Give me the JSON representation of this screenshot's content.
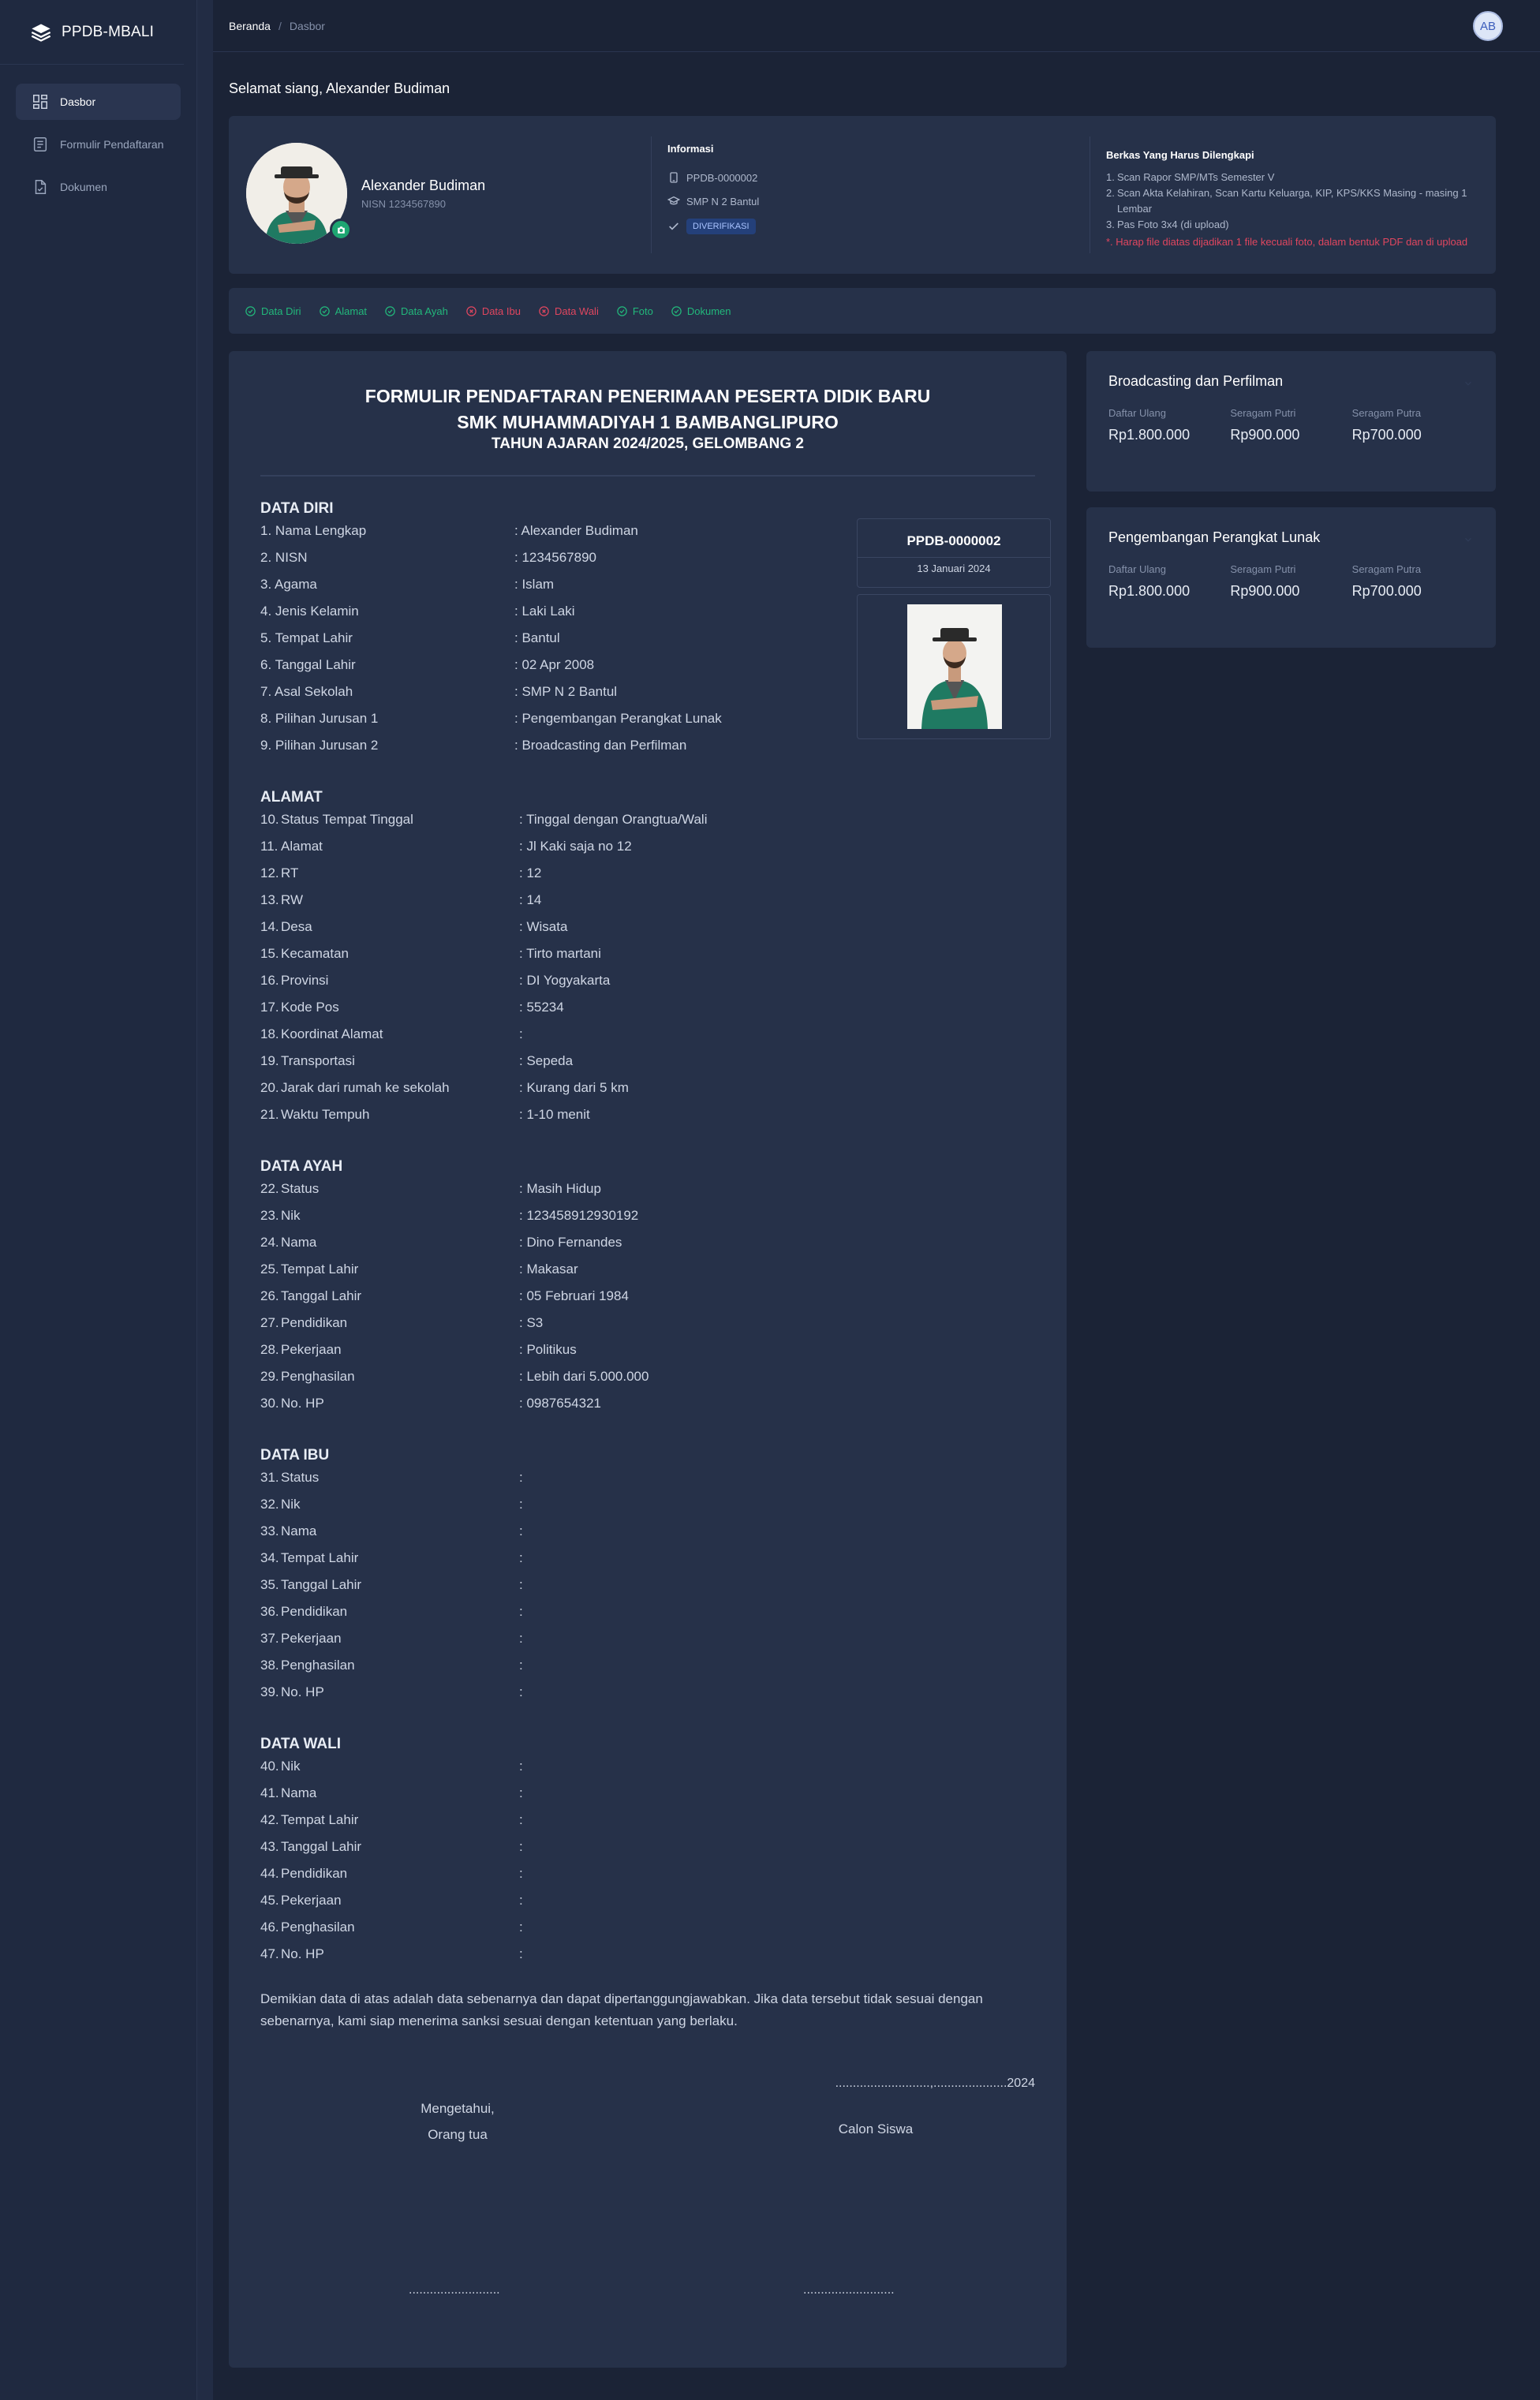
{
  "app": {
    "brand": "PPDB-MBALI",
    "avatar_initials": "AB"
  },
  "sidebar": {
    "items": [
      {
        "label": "Dasbor",
        "icon": "dashboard-icon",
        "active": true
      },
      {
        "label": "Formulir Pendaftaran",
        "icon": "form-icon",
        "active": false
      },
      {
        "label": "Dokumen",
        "icon": "document-icon",
        "active": false
      }
    ]
  },
  "breadcrumb": [
    "Beranda",
    "Dasbor"
  ],
  "greeting": "Selamat siang, Alexander Budiman",
  "profile": {
    "name": "Alexander Budiman",
    "nisn": "NISN 1234567890"
  },
  "info": {
    "title": "Informasi",
    "reg_no": "PPDB-0000002",
    "school": "SMP N 2 Bantul",
    "status": "DIVERIFIKASI"
  },
  "berkas": {
    "title": "Berkas Yang Harus Dilengkapi",
    "items": [
      "Scan Rapor SMP/MTs Semester V",
      "Scan Akta Kelahiran, Scan Kartu Keluarga, KIP, KPS/KKS Masing - masing 1 Lembar",
      "Pas Foto 3x4 (di upload)"
    ],
    "note": "*. Harap file diatas dijadikan 1 file kecuali foto, dalam bentuk PDF dan di upload"
  },
  "steps": [
    {
      "label": "Data Diri",
      "state": "done"
    },
    {
      "label": "Alamat",
      "state": "done"
    },
    {
      "label": "Data Ayah",
      "state": "done"
    },
    {
      "label": "Data Ibu",
      "state": "missing"
    },
    {
      "label": "Data Wali",
      "state": "missing"
    },
    {
      "label": "Foto",
      "state": "done"
    },
    {
      "label": "Dokumen",
      "state": "done"
    }
  ],
  "form": {
    "title1": "FORMULIR PENDAFTARAN PENERIMAAN PESERTA DIDIK BARU",
    "title2": "SMK MUHAMMADIYAH 1 BAMBANGLIPURO",
    "title3": "TAHUN AJARAN 2024/2025, GELOMBANG 2",
    "reg_no": "PPDB-0000002",
    "reg_date": "13 Januari 2024",
    "sections": {
      "diri": {
        "title": "DATA DIRI",
        "rows": [
          {
            "n": "1.",
            "label": "Nama Lengkap",
            "value": ": Alexander Budiman"
          },
          {
            "n": "2.",
            "label": "NISN",
            "value": ": 1234567890"
          },
          {
            "n": "3.",
            "label": "Agama",
            "value": ": Islam"
          },
          {
            "n": "4.",
            "label": "Jenis Kelamin",
            "value": ": Laki Laki"
          },
          {
            "n": "5.",
            "label": "Tempat Lahir",
            "value": ": Bantul"
          },
          {
            "n": "6.",
            "label": "Tanggal Lahir",
            "value": ": 02 Apr 2008"
          },
          {
            "n": "7.",
            "label": "Asal Sekolah",
            "value": ": SMP N 2 Bantul"
          },
          {
            "n": "8.",
            "label": "Pilihan Jurusan 1",
            "value": ": Pengembangan Perangkat Lunak"
          },
          {
            "n": "9.",
            "label": "Pilihan Jurusan 2",
            "value": ": Broadcasting dan Perfilman"
          }
        ]
      },
      "alamat": {
        "title": "ALAMAT",
        "rows": [
          {
            "n": "10.",
            "label": "Status Tempat Tinggal",
            "value": ": Tinggal dengan Orangtua/Wali"
          },
          {
            "n": "11.",
            "label": "Alamat",
            "value": ": Jl Kaki saja no 12"
          },
          {
            "n": "12.",
            "label": "RT",
            "value": ": 12"
          },
          {
            "n": "13.",
            "label": "RW",
            "value": ": 14"
          },
          {
            "n": "14.",
            "label": "Desa",
            "value": ": Wisata"
          },
          {
            "n": "15.",
            "label": "Kecamatan",
            "value": ": Tirto martani"
          },
          {
            "n": "16.",
            "label": "Provinsi",
            "value": ": DI Yogyakarta"
          },
          {
            "n": "17.",
            "label": "Kode Pos",
            "value": ": 55234"
          },
          {
            "n": "18.",
            "label": "Koordinat Alamat",
            "value": ":"
          },
          {
            "n": "19.",
            "label": "Transportasi",
            "value": ": Sepeda"
          },
          {
            "n": "20.",
            "label": "Jarak dari rumah ke sekolah",
            "value": ": Kurang dari 5 km"
          },
          {
            "n": "21.",
            "label": "Waktu Tempuh",
            "value": ": 1-10 menit"
          }
        ]
      },
      "ayah": {
        "title": "DATA AYAH",
        "rows": [
          {
            "n": "22.",
            "label": "Status",
            "value": ": Masih Hidup"
          },
          {
            "n": "23.",
            "label": "Nik",
            "value": ": 123458912930192"
          },
          {
            "n": "24.",
            "label": "Nama",
            "value": ": Dino Fernandes"
          },
          {
            "n": "25.",
            "label": "Tempat Lahir",
            "value": ": Makasar"
          },
          {
            "n": "26.",
            "label": "Tanggal Lahir",
            "value": ": 05 Februari 1984"
          },
          {
            "n": "27.",
            "label": "Pendidikan",
            "value": ": S3"
          },
          {
            "n": "28.",
            "label": "Pekerjaan",
            "value": ": Politikus"
          },
          {
            "n": "29.",
            "label": "Penghasilan",
            "value": ": Lebih dari 5.000.000"
          },
          {
            "n": "30.",
            "label": "No. HP",
            "value": ": 0987654321"
          }
        ]
      },
      "ibu": {
        "title": "DATA IBU",
        "rows": [
          {
            "n": "31.",
            "label": "Status",
            "value": ":"
          },
          {
            "n": "32.",
            "label": "Nik",
            "value": ":"
          },
          {
            "n": "33.",
            "label": "Nama",
            "value": ":"
          },
          {
            "n": "34.",
            "label": "Tempat Lahir",
            "value": ":"
          },
          {
            "n": "35.",
            "label": "Tanggal Lahir",
            "value": ":"
          },
          {
            "n": "36.",
            "label": "Pendidikan",
            "value": ":"
          },
          {
            "n": "37.",
            "label": "Pekerjaan",
            "value": ":"
          },
          {
            "n": "38.",
            "label": "Penghasilan",
            "value": ":"
          },
          {
            "n": "39.",
            "label": "No. HP",
            "value": ":"
          }
        ]
      },
      "wali": {
        "title": "DATA WALI",
        "rows": [
          {
            "n": "40.",
            "label": "Nik",
            "value": ":"
          },
          {
            "n": "41.",
            "label": "Nama",
            "value": ":"
          },
          {
            "n": "42.",
            "label": "Tempat Lahir",
            "value": ":"
          },
          {
            "n": "43.",
            "label": "Tanggal Lahir",
            "value": ":"
          },
          {
            "n": "44.",
            "label": "Pendidikan",
            "value": ":"
          },
          {
            "n": "45.",
            "label": "Pekerjaan",
            "value": ":"
          },
          {
            "n": "46.",
            "label": "Penghasilan",
            "value": ":"
          },
          {
            "n": "47.",
            "label": "No. HP",
            "value": ":"
          }
        ]
      }
    },
    "statement": "Demikian data di atas adalah data sebenarnya dan dapat dipertanggungjawabkan. Jika data tersebut tidak sesuai dengan sebenarnya, kami siap menerima sanksi sesuai dengan ketentuan yang berlaku.",
    "sign_date": "...........................,.....................2024",
    "sign_left_1": "Mengetahui,",
    "sign_left_2": "Orang tua",
    "sign_right": "Calon Siswa",
    "sign_dots": ".........................."
  },
  "fees": [
    {
      "title": "Broadcasting dan Perfilman",
      "items": [
        {
          "label": "Daftar Ulang",
          "value": "Rp1.800.000"
        },
        {
          "label": "Seragam Putri",
          "value": "Rp900.000"
        },
        {
          "label": "Seragam Putra",
          "value": "Rp700.000"
        }
      ]
    },
    {
      "title": "Pengembangan Perangkat Lunak",
      "items": [
        {
          "label": "Daftar Ulang",
          "value": "Rp1.800.000"
        },
        {
          "label": "Seragam Putri",
          "value": "Rp900.000"
        },
        {
          "label": "Seragam Putra",
          "value": "Rp700.000"
        }
      ]
    }
  ],
  "colors": {
    "background": "#1b2336",
    "card": "#263149",
    "success": "#22b87b",
    "danger": "#e0465f",
    "badge": "#24407a"
  }
}
